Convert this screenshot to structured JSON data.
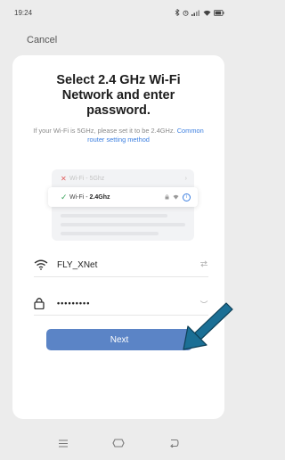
{
  "status_bar": {
    "time": "19:24",
    "icons": [
      "bluetooth-icon",
      "alarm-icon",
      "signal-icon",
      "wifi-icon",
      "battery-icon"
    ]
  },
  "nav": {
    "cancel_label": "Cancel"
  },
  "title": "Select 2.4 GHz Wi-Fi\nNetwork and enter\npassword.",
  "note": {
    "text": "If your Wi-Fi is 5GHz, please set it to be 2.4GHz.",
    "link": "Common router setting method"
  },
  "illustration": {
    "row_5g": {
      "mark": "✕",
      "ssid": "Wi-Fi - ",
      "band": "5Ghz"
    },
    "row_24g": {
      "mark": "✓",
      "ssid": "Wi-Fi - ",
      "band": "2.4Ghz"
    }
  },
  "wifi_field": {
    "icon": "wifi-icon",
    "value": "FLY_XNet",
    "action_icon": "swap-icon"
  },
  "password_field": {
    "icon": "lock-icon",
    "value": "•••••••••",
    "action_icon": "eye-closed-icon"
  },
  "next_button": {
    "label": "Next"
  },
  "colors": {
    "accent": "#5b84c6",
    "arrow": "#1b6f95",
    "link": "#3c7fe0"
  },
  "system_nav": {
    "icons": [
      "menu-icon",
      "home-icon",
      "back-icon"
    ]
  }
}
